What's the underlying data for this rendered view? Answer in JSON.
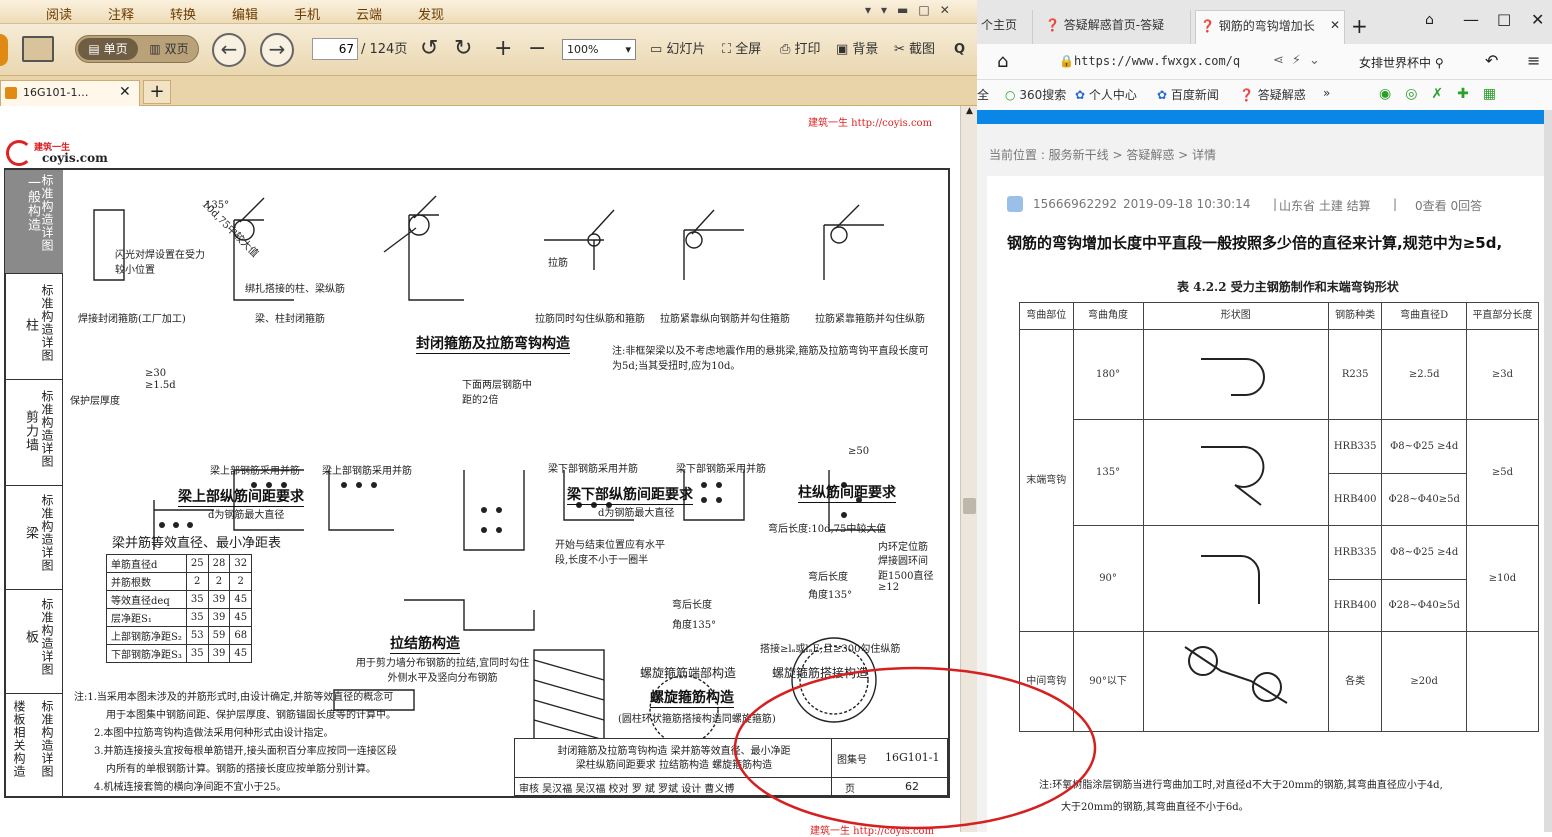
{
  "reader": {
    "menu": [
      "阅读",
      "注释",
      "转换",
      "编辑",
      "手机",
      "云端",
      "发现"
    ],
    "toolbar": {
      "single": "单页",
      "double": "双页",
      "page_current": "67",
      "page_total": "/ 124页",
      "zoom": "100%",
      "slideshow": "幻灯片",
      "fullscreen": "全屏",
      "print": "打印",
      "background": "背景",
      "screenshot": "截图",
      "search": "Q"
    },
    "doc_tab": "16G101-1…",
    "watermark_top": "建筑一生 http://coyis.com",
    "watermark_bottom": "建筑一生 http://coyis.com",
    "logo": {
      "cn": "建筑一生",
      "en": "coyis.com"
    },
    "side": [
      "标准构造详图",
      "标准构造详图",
      "标准构造详图",
      "标准构造详图",
      "标准构造详图",
      "标准构造详图"
    ],
    "side_left": [
      "一般构造",
      "柱",
      "剪力墙",
      "梁",
      "板",
      "楼板相关构造"
    ],
    "captions": {
      "hook": "封闭箍筋及拉筋弯钩构造",
      "beam_top": "梁上部纵筋间距要求",
      "beam_bottom": "梁下部纵筋间距要求",
      "column": "柱纵筋间距要求",
      "tie": "拉结筋构造",
      "spiral": "螺旋箍筋构造",
      "spiral_sub": "(圆柱环状箍筋搭接构造同螺旋箍筋)",
      "table_title": "梁并筋等效直径、最小净距表"
    },
    "subnotes": {
      "beam_top": "d为钢筋最大直径",
      "beam_bottom": "d为钢筋最大直径",
      "tie_note": "用于剪力墙分布钢筋的拉结,宜同时勾住外侧水平及竖向分布钢筋",
      "spiral_end": "螺旋箍筋端部构造",
      "spiral_lap": "螺旋箍筋搭接构造",
      "hook_note": "注:非框架梁以及不考虑地震作用的悬挑梁,箍筋及拉筋弯钩平直段长度可为5d;当其受扭时,应为10d。"
    },
    "labels": {
      "angle": "135°",
      "len": "10d,75中较大值",
      "weld": "闪光对焊设置在受力较小位置",
      "weld_title": "焊接封闭箍筋(工厂加工)",
      "col": "梁、柱封闭箍筋",
      "bind": "绑扎搭接的柱、梁纵筋",
      "tie1": "拉筋同时勾住纵筋和箍筋",
      "tie2": "拉筋紧靠纵向钢筋并勾住箍筋",
      "tie3": "拉筋紧靠箍筋并勾住纵筋",
      "tielabel": "拉筋",
      "cover": "保护层厚度",
      "ge30": "≥30",
      "ge15": "≥1.5d",
      "twice": "下面两层钢筋中距的2倍",
      "bar1": "梁上部钢筋采用并筋",
      "bar2": "梁上部钢筋采用并筋",
      "bar3": "梁下部钢筋采用并筋",
      "bar4": "梁下部钢筋采用并筋",
      "ge50": "≥50",
      "start": "开始与结束位置应有水平段,长度不小于一圈半",
      "hook_len": "弯后长度:10d,75中较大值",
      "inner": "内环定位筋",
      "weld_ring": "焊接圆环间距1500直径≥12",
      "lap": "搭接≥lₐ或lₐE,且≥300勾住纵筋",
      "hook_in": "弯后长度",
      "hook_ang": "角度135°"
    },
    "spacing_table": {
      "rows": [
        [
          "单筋直径d",
          "25",
          "28",
          "32"
        ],
        [
          "并筋根数",
          "2",
          "2",
          "2"
        ],
        [
          "等效直径deq",
          "35",
          "39",
          "45"
        ],
        [
          "层净距S₁",
          "35",
          "39",
          "45"
        ],
        [
          "上部钢筋净距S₂",
          "53",
          "59",
          "68"
        ],
        [
          "下部钢筋净距S₃",
          "35",
          "39",
          "45"
        ]
      ]
    },
    "notes": [
      "注:1.当采用本图未涉及的并筋形式时,由设计确定,并筋等效直径的概念可",
      "用于本图集中钢筋间距、保护层厚度、钢筋锚固长度等的计算中。",
      "2.本图中拉筋弯钩构造做法采用何种形式由设计指定。",
      "3.并筋连接接头宜按每根单筋错开,接头面积百分率应按同一连接区段",
      "内所有的单根钢筋计算。钢筋的搭接长度应按单筋分别计算。",
      "4.机械连接套筒的横向净间距不宜小于25。"
    ],
    "titleblock": {
      "line1": "封闭箍筋及拉筋弯钩构造 梁并筋等效直径、最小净距",
      "line2": "梁柱纵筋间距要求 拉结筋构造 螺旋箍筋构造",
      "atlas_label": "图集号",
      "atlas_no": "16G101-1",
      "page_label": "页",
      "page_no": "62",
      "sign": "审核 吴汉福 吴汉福 校对 罗 斌 罗斌 设计 曹义博"
    }
  },
  "browser": {
    "tabs": [
      "个主页",
      "答疑解惑首页-答疑",
      "钢筋的弯钩增加长"
    ],
    "url": "https://www.fwxgx.com/q",
    "search_placeholder": "女排世界杯中",
    "bookmarks": [
      "全",
      "360搜索",
      "个人中心",
      "百度新闻",
      "答疑解惑",
      "»"
    ],
    "breadcrumb": "当前位置 : 服务新干线 > 答疑解惑 > 详情",
    "meta": {
      "user": "15666962292",
      "time": "2019-09-18 10:30:14",
      "region": "山东省 土建 结算",
      "stats": "0查看 0回答"
    },
    "question": "钢筋的弯钩增加长度中平直段一般按照多少倍的直径来计算,规范中为≥5d,",
    "table_title": "表 4.2.2 受力主钢筋制作和末端弯钩形状",
    "table_headers": [
      "弯曲部位",
      "弯曲角度",
      "形状图",
      "钢筋种类",
      "弯曲直径D",
      "平直部分长度"
    ],
    "table_rows": [
      {
        "part": "",
        "angle": "180°",
        "type": "R235",
        "dia": "≥2.5d",
        "flat": "≥3d"
      },
      {
        "part": "末端弯钩",
        "angle": "135°",
        "type": "HRB335",
        "dia": "Φ8~Φ25 ≥4d",
        "flat": "≥5d"
      },
      {
        "part": "",
        "angle": "",
        "type": "HRB400",
        "dia": "Φ28~Φ40≥5d",
        "flat": ""
      },
      {
        "part": "",
        "angle": "90°",
        "type": "HRB335",
        "dia": "Φ8~Φ25 ≥4d",
        "flat": "≥10d"
      },
      {
        "part": "",
        "angle": "",
        "type": "HRB400",
        "dia": "Φ28~Φ40≥5d",
        "flat": ""
      },
      {
        "part": "中间弯钩",
        "angle": "90°以下",
        "type": "各类",
        "dia": "≥20d",
        "flat": ""
      }
    ],
    "footnote1": "注:环氧树脂涂层钢筋当进行弯曲加工时,对直径d不大于20mm的钢筋,其弯曲直径应小于4d,",
    "footnote2": "大于20mm的钢筋,其弯曲直径不小于6d。"
  },
  "accent": "#0a86e6",
  "annotation_color": "#d62020"
}
